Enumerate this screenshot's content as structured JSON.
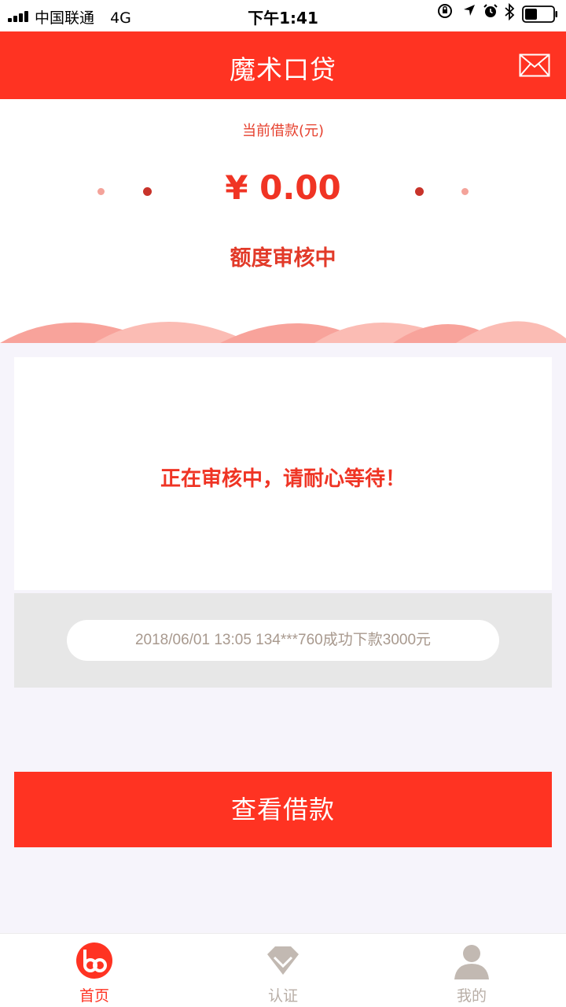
{
  "status_bar": {
    "carrier": "中国联通",
    "network": "4G",
    "time": "下午1:41",
    "icons": [
      "signal-icon",
      "orientation-lock-icon",
      "location-icon",
      "alarm-icon",
      "bluetooth-icon",
      "battery-icon"
    ]
  },
  "header": {
    "title": "魔术口贷",
    "right_icon": "mail-icon"
  },
  "loan": {
    "label": "当前借款(元)",
    "amount": "¥ 0.00",
    "status": "额度审核中"
  },
  "review": {
    "message": "正在审核中，请耐心等待！"
  },
  "ticker": {
    "text": "2018/06/01 13:05 134***760成功下款3000元"
  },
  "cta": {
    "label": "查看借款"
  },
  "nav": {
    "items": [
      {
        "label": "首页",
        "icon": "home-logo-icon",
        "active": true
      },
      {
        "label": "认证",
        "icon": "diamond-icon",
        "active": false
      },
      {
        "label": "我的",
        "icon": "user-icon",
        "active": false
      }
    ]
  },
  "colors": {
    "accent": "#ff3322",
    "nav_inactive": "#c2b9b2",
    "ticker_text": "#a8998e"
  }
}
